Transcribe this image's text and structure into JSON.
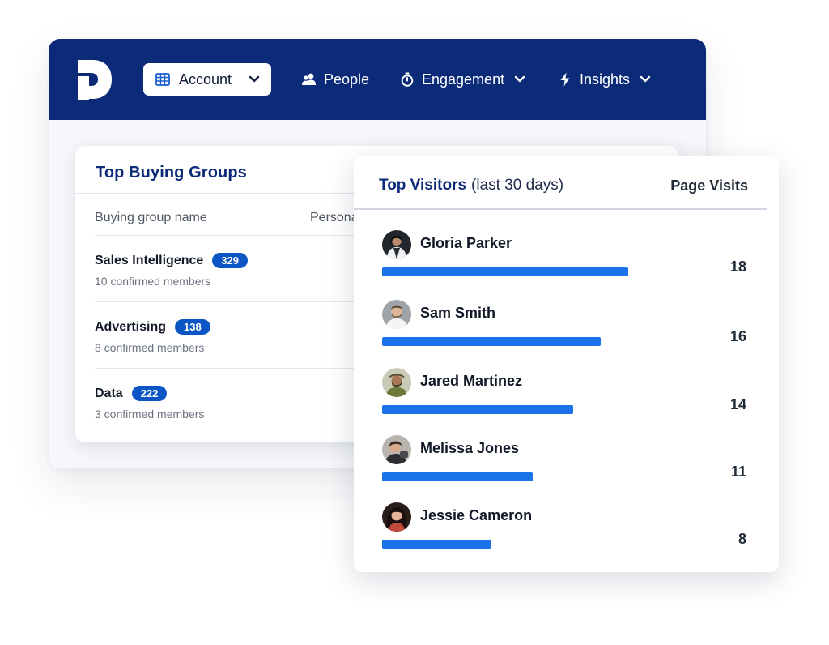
{
  "nav": {
    "account_label": "Account",
    "people_label": "People",
    "engagement_label": "Engagement",
    "insights_label": "Insights",
    "accent_color": "#0b2a78",
    "icons": [
      "building-icon",
      "people-icon",
      "stopwatch-icon",
      "lightning-icon",
      "chevron-down-icon"
    ]
  },
  "buying_groups": {
    "title": "Top Buying Groups",
    "col_name": "Buying group name",
    "col_persona": "Persona",
    "rows": [
      {
        "name": "Sales Intelligence",
        "count": "329",
        "members": "10 confirmed members"
      },
      {
        "name": "Advertising",
        "count": "138",
        "members": "8 confirmed members"
      },
      {
        "name": "Data",
        "count": "222",
        "members": "3 confirmed members"
      }
    ]
  },
  "top_visitors": {
    "title": "Top Visitors",
    "subtitle": "(last 30 days)",
    "col_visits": "Page Visits",
    "bar_color": "#1a73e8",
    "max_visits": 18,
    "visitors": [
      {
        "name": "Gloria Parker",
        "visits": 18,
        "visits_label": "18"
      },
      {
        "name": "Sam Smith",
        "visits": 16,
        "visits_label": "16"
      },
      {
        "name": "Jared Martinez",
        "visits": 14,
        "visits_label": "14"
      },
      {
        "name": "Melissa Jones",
        "visits": 11,
        "visits_label": "11"
      },
      {
        "name": "Jessie Cameron",
        "visits": 8,
        "visits_label": "8"
      }
    ]
  }
}
